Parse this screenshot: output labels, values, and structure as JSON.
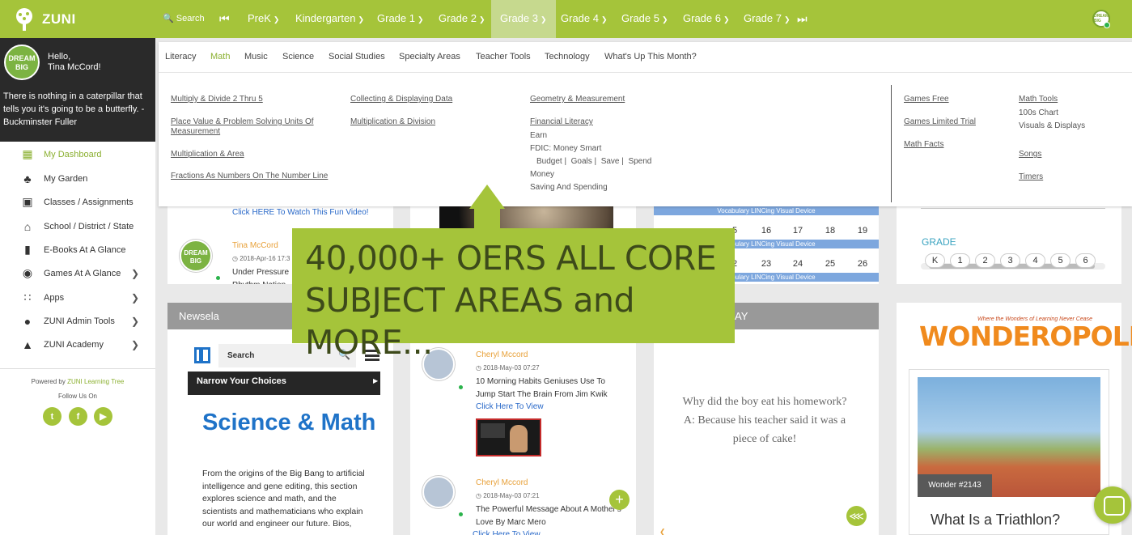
{
  "app": {
    "name": "ZUNI"
  },
  "topnav": {
    "search": "Search",
    "items": [
      "PreK",
      "Kindergarten",
      "Grade 1",
      "Grade 2",
      "Grade 3",
      "Grade 4",
      "Grade 5",
      "Grade 6",
      "Grade 7"
    ],
    "active": "Grade 3",
    "avatar_text": "DREAM BIG"
  },
  "user": {
    "hello": "Hello,",
    "name": "Tina McCord!",
    "avatar_text": "DREAM BIG",
    "quote": "There is nothing in a caterpillar that tells you it's going to be a butterfly. - Buckminster Fuller"
  },
  "sidebar": {
    "items": [
      {
        "label": "My Dashboard",
        "icon": "dashboard-icon"
      },
      {
        "label": "My Garden",
        "icon": "tree-icon"
      },
      {
        "label": "Classes / Assignments",
        "icon": "classroom-icon"
      },
      {
        "label": "School / District / State",
        "icon": "school-icon"
      },
      {
        "label": "E-Books At A Glance",
        "icon": "book-icon"
      },
      {
        "label": "Games At A Glance",
        "icon": "gamepad-icon"
      },
      {
        "label": "Apps",
        "icon": "apps-grid-icon"
      },
      {
        "label": "ZUNI Admin Tools",
        "icon": "users-icon"
      },
      {
        "label": "ZUNI Academy",
        "icon": "academy-icon"
      }
    ],
    "powered_by": "Powered by",
    "powered_link": "ZUNI Learning Tree",
    "follow": "Follow Us On"
  },
  "mega": {
    "tabs": [
      "Literacy",
      "Math",
      "Music",
      "Science",
      "Social Studies",
      "Specialty Areas",
      "Teacher Tools",
      "Technology",
      "What's Up This Month?"
    ],
    "active_tab": "Math",
    "col1": [
      "Multiply & Divide 2 Thru 5",
      "Place Value & Problem Solving Units Of Measurement",
      "Multiplication & Area",
      "Fractions As Numbers On The Number Line"
    ],
    "col2": [
      "Collecting & Displaying Data",
      "Multiplication & Division"
    ],
    "col3": {
      "links": [
        "Geometry & Measurement",
        "Financial Literacy"
      ],
      "earn": "Earn",
      "fdic": "FDIC: Money Smart",
      "money_items": [
        "Budget",
        "Goals",
        "Save",
        "Spend"
      ],
      "money": "Money",
      "saving": "Saving And Spending"
    },
    "col4": [
      "Games Free",
      "Games Limited Trial",
      "Math Facts"
    ],
    "col5": {
      "tools": "Math Tools",
      "chart": "100s Chart",
      "visuals": "Visuals & Displays",
      "songs": "Songs",
      "timers": "Timers"
    }
  },
  "banner": {
    "line1": "40,000+ OERS ALL CORE",
    "line2": "SUBJECT AREAS and MORE..."
  },
  "post_top": {
    "video_link": "Click HERE To Watch This Fun Video!",
    "author": "Tina McCord",
    "time": "2018-Apr-16 17:3",
    "text": "Under Pressure",
    "text2": "Rhythm Nation"
  },
  "calendar": {
    "bar": "Vocabulary LINCing Visual Device",
    "row1": [
      "5",
      "16",
      "17",
      "18",
      "19"
    ],
    "row2": [
      "2",
      "23",
      "24",
      "25",
      "26"
    ]
  },
  "grade": {
    "label": "GRADE",
    "buttons": [
      "K",
      "1",
      "2",
      "3",
      "4",
      "5",
      "6"
    ]
  },
  "newsela": {
    "header": "Newsela",
    "search": "Search",
    "narrow": "Narrow Your Choices",
    "title": "Science & Math",
    "desc": "From the origins of the Big Bang to artificial intelligence and gene editing, this section explores science and math, and the scientists and mathematicians who explain our world and engineer our future. Bios,"
  },
  "feed": [
    {
      "author": "Cheryl Mccord",
      "time": "2018-May-03 07:27",
      "text": "10 Morning Habits Geniuses Use To Jump Start The Brain From Jim Kwik",
      "link": "Click Here To View"
    },
    {
      "author": "Cheryl Mccord",
      "time": "2018-May-03 07:21",
      "text": "The Powerful Message About A Mother's Love By Marc Mero",
      "link": "Click Here To View"
    }
  ],
  "joke": {
    "header": "AY",
    "question": "Why did the boy eat his homework?",
    "answer": "A: Because his teacher said it was a piece of cake!"
  },
  "wonder": {
    "logo": "WONDEROPOLIS",
    "tagline": "Where the Wonders of Learning Never Cease",
    "number": "Wonder #2143",
    "question": "What Is a Triathlon?"
  },
  "colors": {
    "brand": "#a5c43a",
    "link": "#2868c8",
    "accent_orange": "#e8a13a",
    "newsela_blue": "#1f73c8"
  }
}
